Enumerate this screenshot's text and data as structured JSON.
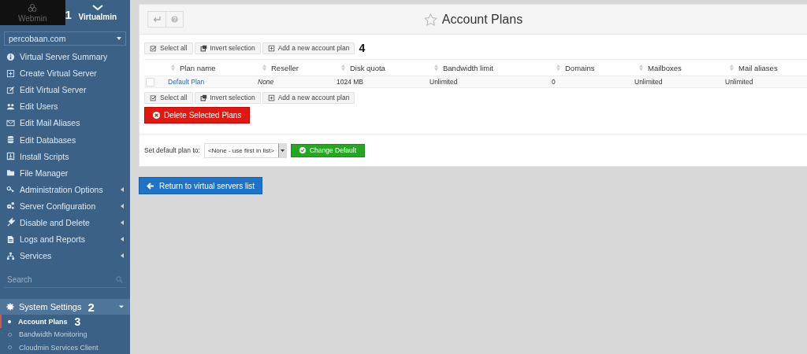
{
  "switcher": {
    "tabs": [
      {
        "label": "Webmin",
        "selected": false
      },
      {
        "label": "Virtualmin",
        "selected": true,
        "callout": "1"
      }
    ]
  },
  "domain_select": {
    "value": "percobaan.com"
  },
  "menu": [
    {
      "label": "Virtual Server Summary",
      "expandable": false
    },
    {
      "label": "Create Virtual Server",
      "expandable": false
    },
    {
      "label": "Edit Virtual Server",
      "expandable": false
    },
    {
      "label": "Edit Users",
      "expandable": false
    },
    {
      "label": "Edit Mail Aliases",
      "expandable": false
    },
    {
      "label": "Edit Databases",
      "expandable": false
    },
    {
      "label": "Install Scripts",
      "expandable": false
    },
    {
      "label": "File Manager",
      "expandable": false
    },
    {
      "label": "Administration Options",
      "expandable": true
    },
    {
      "label": "Server Configuration",
      "expandable": true
    },
    {
      "label": "Disable and Delete",
      "expandable": true
    },
    {
      "label": "Logs and Reports",
      "expandable": true
    },
    {
      "label": "Services",
      "expandable": true
    }
  ],
  "search": {
    "placeholder": "Search"
  },
  "system_settings": {
    "label": "System Settings",
    "expanded": true,
    "callout": "2",
    "children": [
      {
        "label": "Account Plans",
        "selected": true,
        "callout": "3"
      },
      {
        "label": "Bandwidth Monitoring",
        "selected": false
      },
      {
        "label": "Cloudmin Services Client",
        "selected": false
      }
    ]
  },
  "header": {
    "title": "Account Plans"
  },
  "toolbar_top": {
    "callout": "4",
    "buttons": [
      {
        "label": "Select all"
      },
      {
        "label": "Invert selection"
      },
      {
        "label": "Add a new account plan"
      }
    ]
  },
  "table": {
    "columns": [
      "Plan name",
      "Reseller",
      "Disk quota",
      "Bandwidth limit",
      "Domains",
      "Mailboxes",
      "Mail aliases"
    ],
    "rows": [
      {
        "checked": false,
        "cells": [
          "Default Plan",
          "None",
          "1024 MB",
          "Unlimited",
          "0",
          "Unlimited",
          "Unlimited"
        ]
      }
    ]
  },
  "toolbar_bottom": {
    "buttons": [
      {
        "label": "Select all"
      },
      {
        "label": "Invert selection"
      },
      {
        "label": "Add a new account plan"
      }
    ]
  },
  "delete_button": "Delete Selected Plans",
  "default_plan": {
    "label": "Set default plan to:",
    "value": "<None - use first in list>",
    "button": "Change Default"
  },
  "return_button": "Return to virtual servers list"
}
